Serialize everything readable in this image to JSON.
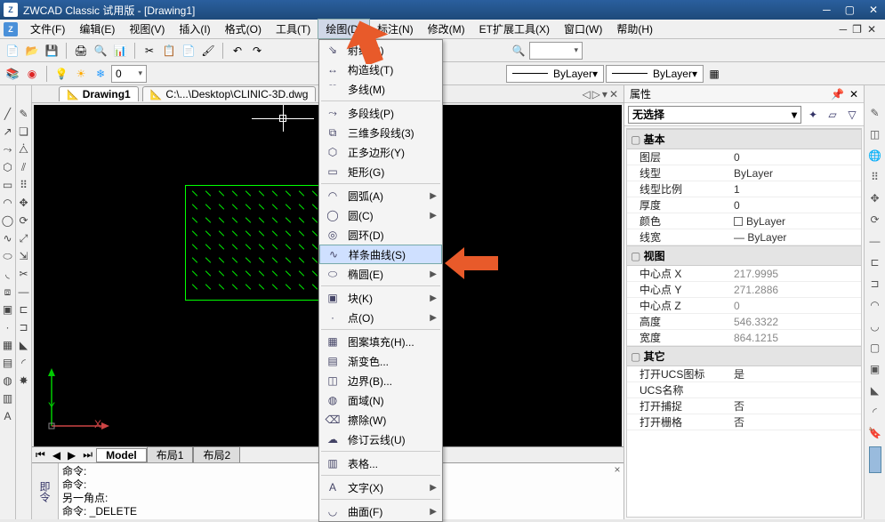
{
  "title": "ZWCAD Classic 试用版 - [Drawing1]",
  "menu": {
    "file": "文件(F)",
    "edit": "编辑(E)",
    "view": "视图(V)",
    "insert": "插入(I)",
    "format": "格式(O)",
    "tools": "工具(T)",
    "draw": "绘图(D)",
    "dim": "标注(N)",
    "modify": "修改(M)",
    "et": "ET扩展工具(X)",
    "window": "窗口(W)",
    "help": "帮助(H)"
  },
  "docTabs": {
    "active": "Drawing1",
    "other": "C:\\...\\Desktop\\CLINIC-3D.dwg"
  },
  "layerCombo": {
    "layerIcons": "✎✗☀❄",
    "layer0": "0"
  },
  "lineCombo1": "ByLayer",
  "lineCombo2": "ByLayer",
  "dropdown": {
    "items": [
      {
        "icon": "⇘",
        "label": "射线(R)",
        "sub": false
      },
      {
        "icon": "↔",
        "label": "构造线(T)",
        "sub": false
      },
      {
        "icon": "﹊",
        "label": "多线(M)",
        "sub": false
      },
      {
        "sep": true
      },
      {
        "icon": "⤳",
        "label": "多段线(P)",
        "sub": false
      },
      {
        "icon": "⧉",
        "label": "三维多段线(3)",
        "sub": false
      },
      {
        "icon": "⬡",
        "label": "正多边形(Y)",
        "sub": false
      },
      {
        "icon": "▭",
        "label": "矩形(G)",
        "sub": false
      },
      {
        "sep": true
      },
      {
        "icon": "◠",
        "label": "圆弧(A)",
        "sub": true
      },
      {
        "icon": "◯",
        "label": "圆(C)",
        "sub": true
      },
      {
        "icon": "◎",
        "label": "圆环(D)",
        "sub": false
      },
      {
        "icon": "∿",
        "label": "样条曲线(S)",
        "sub": false,
        "hl": true
      },
      {
        "icon": "⬭",
        "label": "椭圆(E)",
        "sub": true
      },
      {
        "sep": true
      },
      {
        "icon": "▣",
        "label": "块(K)",
        "sub": true
      },
      {
        "icon": "·",
        "label": "点(O)",
        "sub": true
      },
      {
        "sep": true
      },
      {
        "icon": "▦",
        "label": "图案填充(H)...",
        "sub": false
      },
      {
        "icon": "▤",
        "label": "渐变色...",
        "sub": false
      },
      {
        "icon": "◫",
        "label": "边界(B)...",
        "sub": false
      },
      {
        "icon": "◍",
        "label": "面域(N)",
        "sub": false
      },
      {
        "icon": "⌫",
        "label": "擦除(W)",
        "sub": false
      },
      {
        "icon": "☁",
        "label": "修订云线(U)",
        "sub": false
      },
      {
        "sep": true
      },
      {
        "icon": "▥",
        "label": "表格...",
        "sub": false
      },
      {
        "sep": true
      },
      {
        "icon": "A",
        "label": "文字(X)",
        "sub": true
      },
      {
        "sep": true
      },
      {
        "icon": "◡",
        "label": "曲面(F)",
        "sub": true
      }
    ]
  },
  "modelTabs": {
    "model": "Model",
    "layout1": "布局1",
    "layout2": "布局2"
  },
  "cmd": {
    "l1": "命令:",
    "l2": "命令:",
    "l3": "另一角点:",
    "l4": "命令:  _DELETE"
  },
  "cmdHandle": "即令",
  "prop": {
    "title": "属性",
    "noSel": "无选择",
    "sections": {
      "basic": "基本",
      "view": "视图",
      "other": "其它"
    },
    "rows": {
      "layer_k": "图层",
      "layer_v": "0",
      "ltype_k": "线型",
      "ltype_v": "ByLayer",
      "ltscale_k": "线型比例",
      "ltscale_v": "1",
      "thick_k": "厚度",
      "thick_v": "0",
      "color_k": "颜色",
      "color_v": "ByLayer",
      "lweight_k": "线宽",
      "lweight_v": "ByLayer",
      "cx_k": "中心点 X",
      "cx_v": "217.9995",
      "cy_k": "中心点 Y",
      "cy_v": "271.2886",
      "cz_k": "中心点 Z",
      "cz_v": "0",
      "h_k": "高度",
      "h_v": "546.3322",
      "w_k": "宽度",
      "w_v": "864.1215",
      "ucs_k": "打开UCS图标",
      "ucs_v": "是",
      "ucsn_k": "UCS名称",
      "ucsn_v": "",
      "snap_k": "打开捕捉",
      "snap_v": "否",
      "grid_k": "打开栅格",
      "grid_v": "否"
    }
  },
  "axis": {
    "x": "X",
    "y": "Y"
  }
}
